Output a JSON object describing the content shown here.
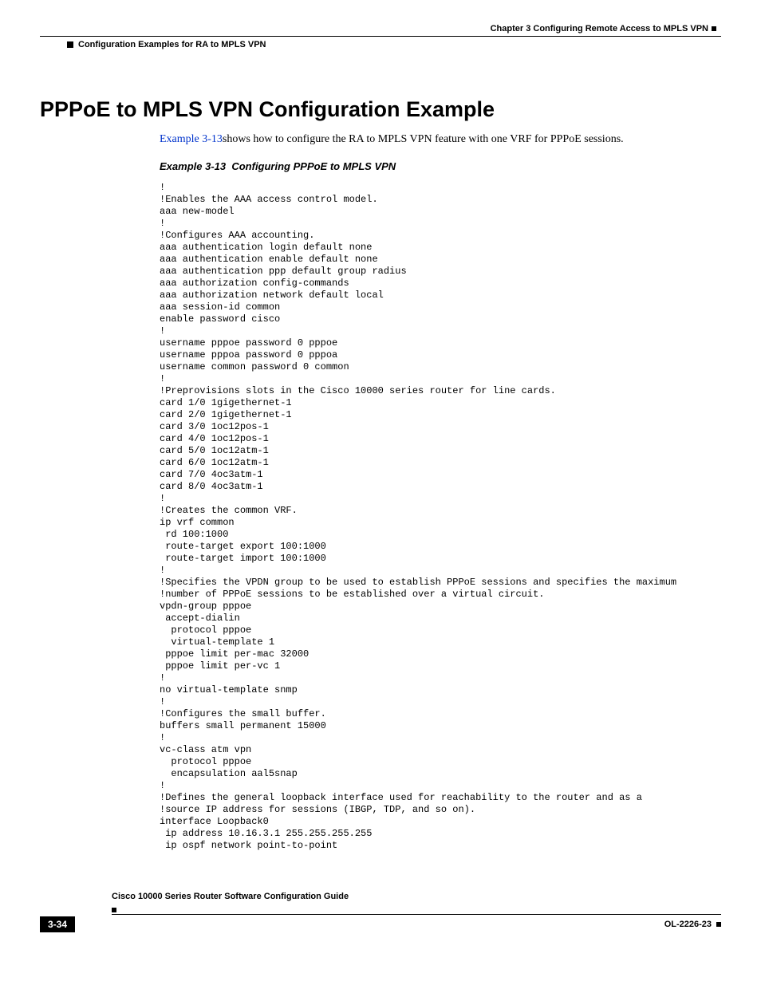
{
  "header": {
    "chapter": "Chapter 3    Configuring Remote Access to MPLS VPN",
    "subsection": "Configuration Examples for RA to MPLS VPN"
  },
  "section_title": "PPPoE to MPLS VPN Configuration Example",
  "intro_link": "Example 3-13",
  "intro_rest": "shows how to configure the RA to MPLS VPN feature with one VRF for PPPoE sessions.",
  "example_label": "Example 3-13",
  "example_title": "Configuring PPPoE to MPLS VPN",
  "code": "!\n!Enables the AAA access control model.\naaa new-model\n!\n!Configures AAA accounting.\naaa authentication login default none\naaa authentication enable default none\naaa authentication ppp default group radius\naaa authorization config-commands\naaa authorization network default local\naaa session-id common\nenable password cisco\n!\nusername pppoe password 0 pppoe\nusername pppoa password 0 pppoa\nusername common password 0 common\n!\n!Preprovisions slots in the Cisco 10000 series router for line cards.\ncard 1/0 1gigethernet-1\ncard 2/0 1gigethernet-1\ncard 3/0 1oc12pos-1\ncard 4/0 1oc12pos-1\ncard 5/0 1oc12atm-1\ncard 6/0 1oc12atm-1\ncard 7/0 4oc3atm-1\ncard 8/0 4oc3atm-1\n!\n!Creates the common VRF.\nip vrf common\n rd 100:1000\n route-target export 100:1000\n route-target import 100:1000\n!\n!Specifies the VPDN group to be used to establish PPPoE sessions and specifies the maximum\n!number of PPPoE sessions to be established over a virtual circuit.\nvpdn-group pppoe\n accept-dialin\n  protocol pppoe\n  virtual-template 1\n pppoe limit per-mac 32000\n pppoe limit per-vc 1\n!\nno virtual-template snmp\n!\n!Configures the small buffer.\nbuffers small permanent 15000\n!\nvc-class atm vpn\n  protocol pppoe\n  encapsulation aal5snap\n!\n!Defines the general loopback interface used for reachability to the router and as a\n!source IP address for sessions (IBGP, TDP, and so on).\ninterface Loopback0\n ip address 10.16.3.1 255.255.255.255\n ip ospf network point-to-point",
  "footer": {
    "guide": "Cisco 10000 Series Router Software Configuration Guide",
    "page": "3-34",
    "docid": "OL-2226-23"
  }
}
